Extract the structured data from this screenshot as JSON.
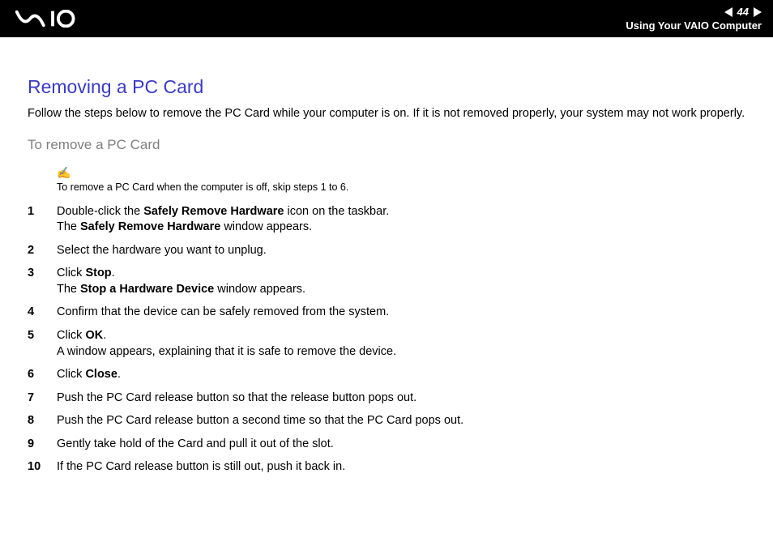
{
  "header": {
    "page_number": "44",
    "section_title": "Using Your VAIO Computer"
  },
  "content": {
    "heading": "Removing a PC Card",
    "intro": "Follow the steps below to remove the PC Card while your computer is on. If it is not removed properly, your system may not work properly.",
    "sub_heading": "To remove a PC Card",
    "note": "To remove a PC Card when the computer is off, skip steps 1 to 6.",
    "steps": [
      {
        "n": "1",
        "html": "Double-click the <strong>Safely Remove Hardware</strong> icon on the taskbar.<br>The <strong>Safely Remove Hardware</strong> window appears."
      },
      {
        "n": "2",
        "html": "Select the hardware you want to unplug."
      },
      {
        "n": "3",
        "html": "Click <strong>Stop</strong>.<br>The <strong>Stop a Hardware Device</strong> window appears."
      },
      {
        "n": "4",
        "html": "Confirm that the device can be safely removed from the system."
      },
      {
        "n": "5",
        "html": "Click <strong>OK</strong>.<br>A window appears, explaining that it is safe to remove the device."
      },
      {
        "n": "6",
        "html": "Click <strong>Close</strong>."
      },
      {
        "n": "7",
        "html": "Push the PC Card release button so that the release button pops out."
      },
      {
        "n": "8",
        "html": "Push the PC Card release button a second time so that the PC Card pops out."
      },
      {
        "n": "9",
        "html": "Gently take hold of the Card and pull it out of the slot."
      },
      {
        "n": "10",
        "html": "If the PC Card release button is still out, push it back in."
      }
    ]
  }
}
